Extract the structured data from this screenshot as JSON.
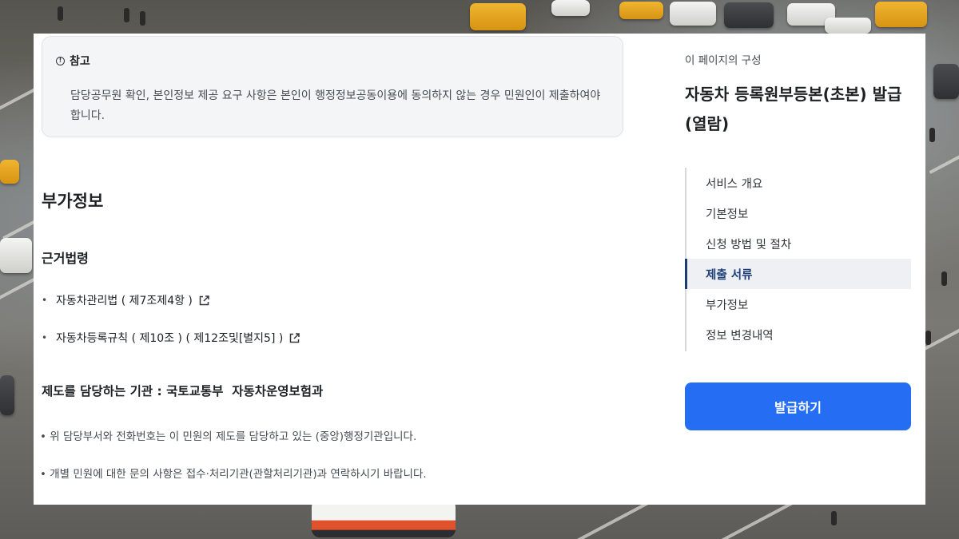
{
  "notice": {
    "title": "참고",
    "body": "담당공무원 확인, 본인정보 제공 요구 사항은 본인이 행정정보공동이용에 동의하지 않는 경우 민원인이 제출하여야 합니다."
  },
  "additional": {
    "section_title": "부가정보",
    "legal_basis_title": "근거법령",
    "laws": [
      {
        "label": "자동차관리법 ( 제7조제4항 )"
      },
      {
        "label": "자동차등록규칙 ( 제10조 ) ( 제12조및[별지5] )"
      }
    ],
    "agency_line": "제도를 담당하는 기관 : 국토교통부  자동차운영보험과",
    "notes": [
      "• 위 담당부서와 전화번호는 이 민원의 제도를 담당하고 있는 (중앙)행정기관입니다.",
      "• 개별 민원에 대한 문의 사항은 접수·처리기관(관할처리기관)과 연락하시기 바랍니다."
    ]
  },
  "sidebar": {
    "toc_label": "이 페이지의 구성",
    "page_title": "자동차 등록원부등본(초본) 발급(열람)",
    "toc": [
      {
        "label": "서비스 개요",
        "active": false
      },
      {
        "label": "기본정보",
        "active": false
      },
      {
        "label": "신청 방법 및 절차",
        "active": false
      },
      {
        "label": "제출 서류",
        "active": true
      },
      {
        "label": "부가정보",
        "active": false
      },
      {
        "label": "정보 변경내역",
        "active": false
      }
    ],
    "issue_button": "발급하기"
  },
  "colors": {
    "primary_button": "#256ef4",
    "active_toc_bar": "#1d3b73",
    "active_toc_bg": "#eef0f3",
    "notice_bg": "#f4f5f6"
  },
  "icons": {
    "notice": "info-circle-icon",
    "law_link": "external-link-icon"
  }
}
